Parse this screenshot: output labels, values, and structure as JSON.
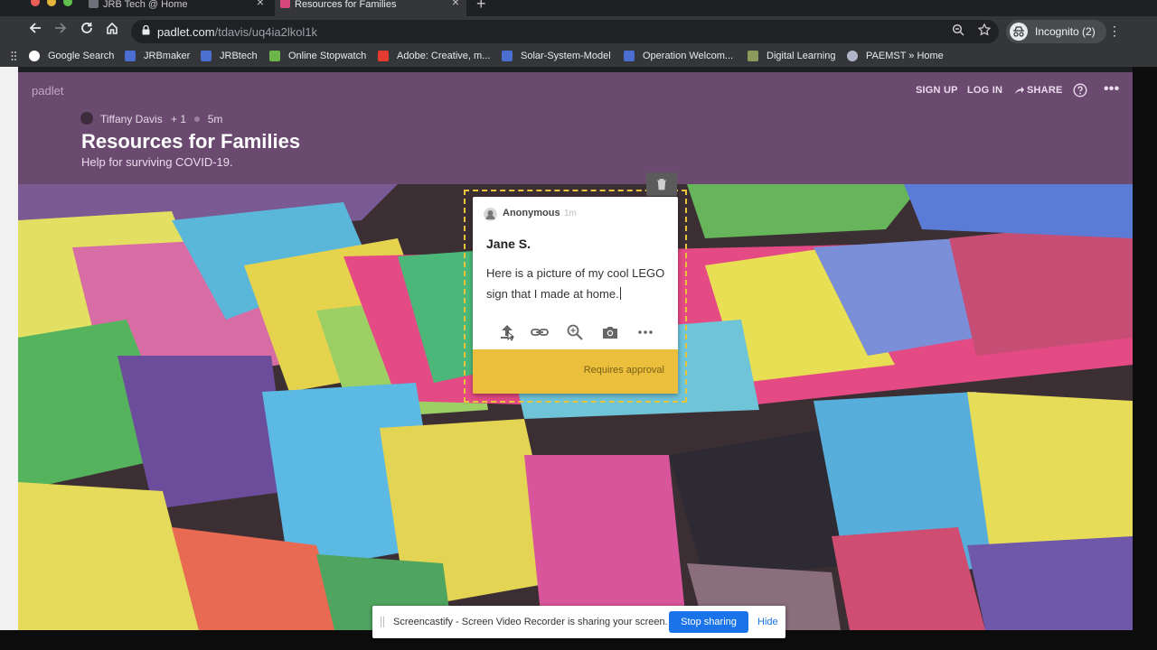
{
  "browser": {
    "tabs": [
      {
        "label": "JRB Tech @ Home",
        "active": false
      },
      {
        "label": "Resources for Families",
        "active": true
      }
    ],
    "url_host": "padlet.com",
    "url_path": "/tdavis/uq4ia2lkol1k",
    "profile_label": "Incognito (2)",
    "bookmarks": [
      {
        "label": "Google Search",
        "icon": "google-icon",
        "color": "#ffffff"
      },
      {
        "label": "JRBmaker",
        "icon": "site-icon",
        "color": "#4a6fd0"
      },
      {
        "label": "JRBtech",
        "icon": "site-icon",
        "color": "#4a6fd0"
      },
      {
        "label": "Online Stopwatch",
        "icon": "stopwatch-icon",
        "color": "#6bb54a"
      },
      {
        "label": "Adobe: Creative, m...",
        "icon": "adobe-icon",
        "color": "#e33b2e"
      },
      {
        "label": "Solar-System-Model",
        "icon": "site-icon",
        "color": "#4a6fd0"
      },
      {
        "label": "Operation Welcom...",
        "icon": "site-icon",
        "color": "#4a6fd0"
      },
      {
        "label": "Digital Learning",
        "icon": "classroom-icon",
        "color": "#8a9a5b"
      },
      {
        "label": "PAEMST » Home",
        "icon": "globe-icon",
        "color": "#b0b6c8"
      }
    ]
  },
  "padlet": {
    "logo": "padlet",
    "actions": {
      "sign_up": "SIGN UP",
      "log_in": "LOG IN",
      "share": "SHARE"
    },
    "author": "Tiffany Davis",
    "contributors": "+ 1",
    "age": "5m",
    "title": "Resources for Families",
    "subtitle": "Help for surviving COVID-19.",
    "accent": "#6a4a6f"
  },
  "post": {
    "author": "Anonymous",
    "time": "1m",
    "title": "Jane S.",
    "body": "Here is a picture of my cool LEGO sign that I made at home.",
    "status": "Requires approval",
    "footer_color": "#ebbf3c",
    "tools": [
      "upload-icon",
      "link-icon",
      "search-icon",
      "camera-icon",
      "more-icon"
    ]
  },
  "sharebar": {
    "message": "Screencastify - Screen Video Recorder is sharing your screen.",
    "stop_label": "Stop sharing",
    "hide_label": "Hide"
  }
}
